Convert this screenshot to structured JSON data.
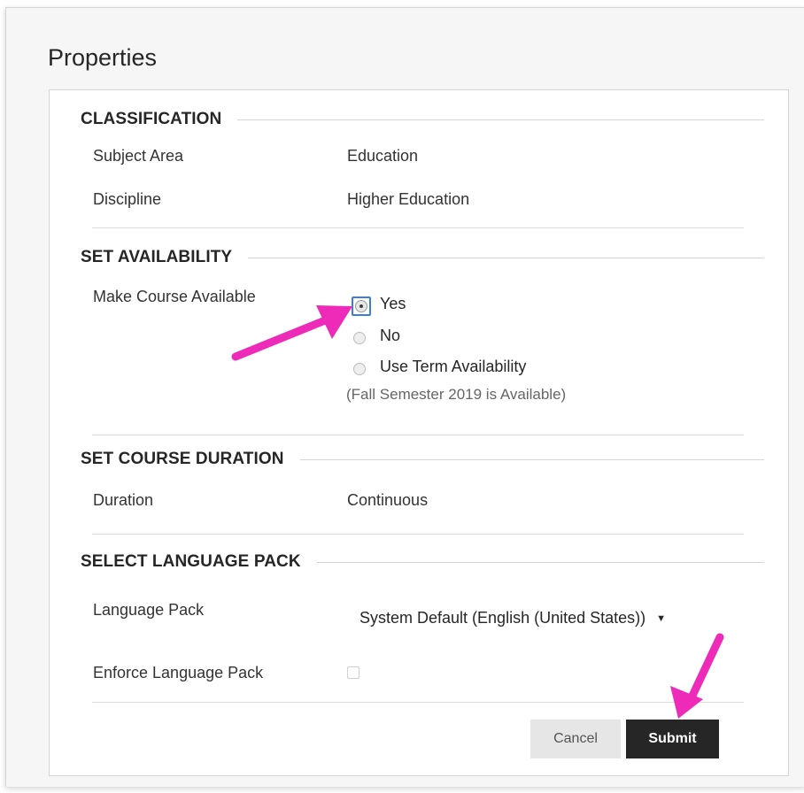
{
  "page": {
    "title": "Properties"
  },
  "sections": {
    "classification": {
      "heading": "CLASSIFICATION",
      "subject_area_label": "Subject Area",
      "subject_area_value": "Education",
      "discipline_label": "Discipline",
      "discipline_value": "Higher Education"
    },
    "availability": {
      "heading": "SET AVAILABILITY",
      "make_available_label": "Make Course Available",
      "options": [
        "Yes",
        "No",
        "Use Term Availability"
      ],
      "selected_option": "Yes",
      "term_note": "(Fall Semester 2019 is Available)"
    },
    "duration": {
      "heading": "SET COURSE DURATION",
      "duration_label": "Duration",
      "duration_value": "Continuous"
    },
    "language": {
      "heading": "SELECT LANGUAGE PACK",
      "language_pack_label": "Language Pack",
      "language_pack_value": "System Default (English (United States))",
      "enforce_label": "Enforce Language Pack",
      "enforce_checked": false
    }
  },
  "buttons": {
    "cancel": "Cancel",
    "submit": "Submit"
  },
  "colors": {
    "annotation_arrow": "#ee2bb8",
    "focus_ring": "#3b7dd8",
    "submit_bg": "#262626",
    "cancel_bg": "#e6e6e6"
  },
  "icons": {
    "select_caret": "caret-down-icon",
    "annotation": "pointer-arrow-icon"
  }
}
